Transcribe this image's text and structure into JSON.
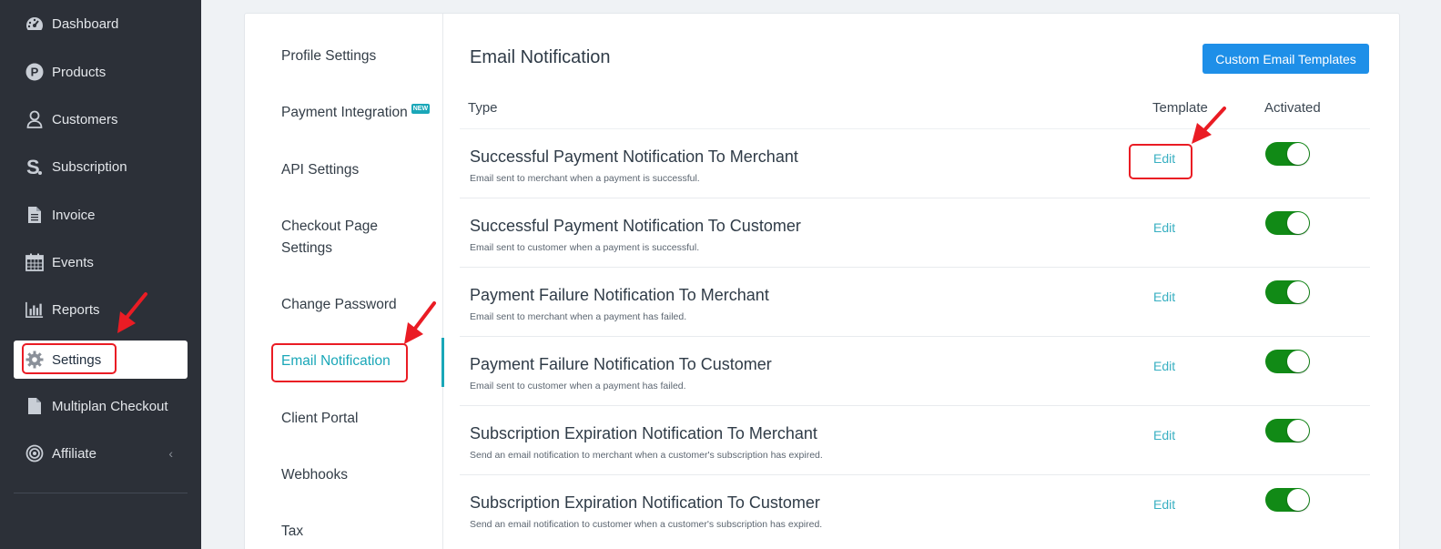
{
  "sidebar": {
    "items": [
      {
        "label": "Dashboard",
        "icon": "dashboard-icon"
      },
      {
        "label": "Products",
        "icon": "products-icon"
      },
      {
        "label": "Customers",
        "icon": "customers-icon"
      },
      {
        "label": "Subscription",
        "icon": "subscription-icon"
      },
      {
        "label": "Invoice",
        "icon": "invoice-icon"
      },
      {
        "label": "Events",
        "icon": "calendar-icon"
      },
      {
        "label": "Reports",
        "icon": "reports-icon"
      },
      {
        "label": "Settings",
        "icon": "gear-icon"
      },
      {
        "label": "Multiplan Checkout",
        "icon": "document-icon"
      },
      {
        "label": "Affiliate",
        "icon": "target-icon"
      }
    ],
    "active": "Settings"
  },
  "settings_nav": {
    "items": [
      {
        "label": "Profile Settings"
      },
      {
        "label": "Payment Integration",
        "badge": "NEW"
      },
      {
        "label": "API Settings"
      },
      {
        "label": "Checkout Page Settings"
      },
      {
        "label": "Change Password"
      },
      {
        "label": "Email Notification"
      },
      {
        "label": "Client Portal"
      },
      {
        "label": "Webhooks"
      },
      {
        "label": "Tax"
      }
    ],
    "active": "Email Notification"
  },
  "main": {
    "title": "Email Notification",
    "custom_templates_button": "Custom Email Templates",
    "columns": {
      "type": "Type",
      "template": "Template",
      "activated": "Activated"
    },
    "rows": [
      {
        "title": "Successful Payment Notification To Merchant",
        "description": "Email sent to merchant when a payment is successful.",
        "action": "Edit",
        "activated": true
      },
      {
        "title": "Successful Payment Notification To Customer",
        "description": "Email sent to customer when a payment is successful.",
        "action": "Edit",
        "activated": true
      },
      {
        "title": "Payment Failure Notification To Merchant",
        "description": "Email sent to merchant when a payment has failed.",
        "action": "Edit",
        "activated": true
      },
      {
        "title": "Payment Failure Notification To Customer",
        "description": "Email sent to customer when a payment has failed.",
        "action": "Edit",
        "activated": true
      },
      {
        "title": "Subscription Expiration Notification To Merchant",
        "description": "Send an email notification to merchant when a customer's subscription has expired.",
        "action": "Edit",
        "activated": true
      },
      {
        "title": "Subscription Expiration Notification To Customer",
        "description": "Send an email notification to customer when a customer's subscription has expired.",
        "action": "Edit",
        "activated": true
      }
    ]
  },
  "colors": {
    "sidebar_bg": "#2c3038",
    "accent_teal": "#1aa7b8",
    "button_blue": "#1e8fe8",
    "toggle_on": "#118a16",
    "annotation_red": "#ea1c24"
  }
}
